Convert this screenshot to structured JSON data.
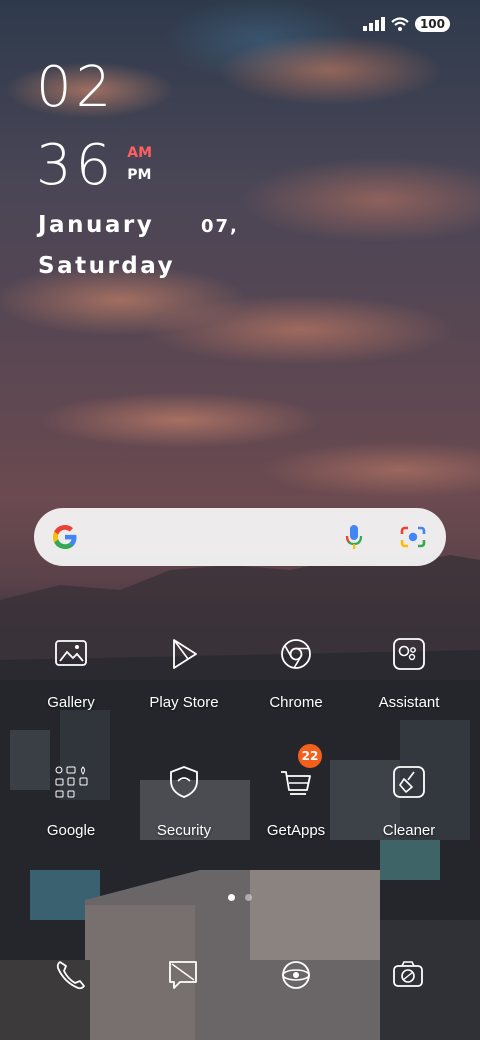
{
  "status": {
    "battery": "100"
  },
  "clock": {
    "hour": "02",
    "minute": "36",
    "am": "AM",
    "pm": "PM"
  },
  "date": {
    "month": "January",
    "day": "07,",
    "weekday": "Saturday"
  },
  "search": {
    "icons": [
      "google-g-icon",
      "microphone-icon",
      "google-lens-icon"
    ],
    "colors": {
      "blue": "#4285F4",
      "red": "#EA4335",
      "yellow": "#FBBC05",
      "green": "#34A853"
    }
  },
  "apps_row1": [
    {
      "label": "Gallery",
      "icon": "gallery-icon"
    },
    {
      "label": "Play Store",
      "icon": "play-store-icon"
    },
    {
      "label": "Chrome",
      "icon": "chrome-icon"
    },
    {
      "label": "Assistant",
      "icon": "assistant-icon"
    }
  ],
  "apps_row2": [
    {
      "label": "Google",
      "icon": "google-folder-icon"
    },
    {
      "label": "Security",
      "icon": "security-icon"
    },
    {
      "label": "GetApps",
      "icon": "getapps-icon",
      "badge": "22"
    },
    {
      "label": "Cleaner",
      "icon": "cleaner-icon"
    }
  ],
  "dock": [
    "phone-icon",
    "messages-icon",
    "browser-icon",
    "camera-icon"
  ],
  "page_indicator": {
    "pages": 2,
    "current": 1
  },
  "colors": {
    "am_accent": "#ff5f5f",
    "badge": "#f4601c"
  }
}
